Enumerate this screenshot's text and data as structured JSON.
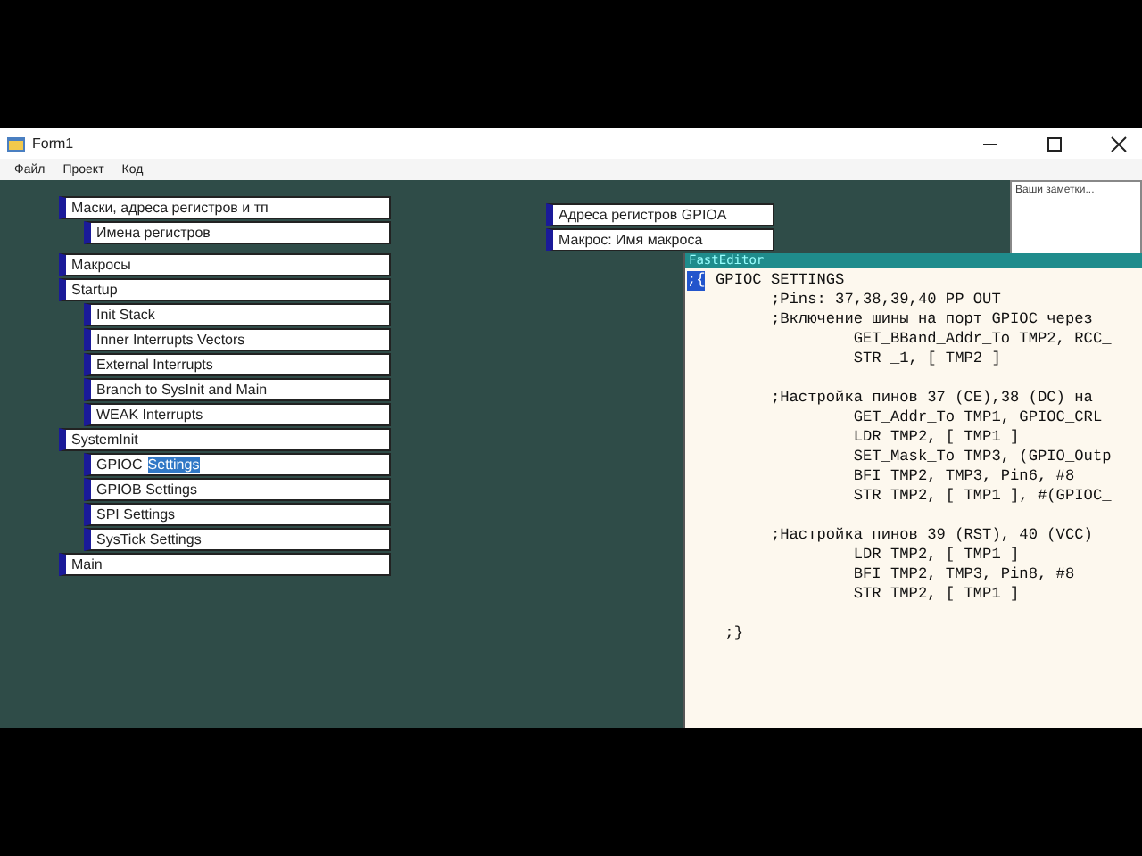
{
  "window": {
    "title": "Form1"
  },
  "menu": [
    "Файл",
    "Проект",
    "Код"
  ],
  "tree_groups": [
    [
      {
        "label": "Маски, адреса регистров и тп",
        "children": [
          {
            "label": "Имена регистров"
          }
        ]
      }
    ],
    [
      {
        "label": "Макросы"
      },
      {
        "label": "Startup",
        "children": [
          {
            "label": "Init Stack"
          },
          {
            "label": "Inner Interrupts Vectors"
          },
          {
            "label": "External Interrupts"
          },
          {
            "label": "Branch to SysInit and Main"
          },
          {
            "label": "WEAK Interrupts"
          }
        ]
      },
      {
        "label": "SystemInit",
        "children": [
          {
            "label": "GPIOC",
            "selected_text": "Settings"
          },
          {
            "label": "GPIOB Settings"
          },
          {
            "label": "SPI Settings"
          },
          {
            "label": "SysTick Settings"
          }
        ]
      },
      {
        "label": "Main"
      }
    ]
  ],
  "floating_nodes": [
    "Адреса регистров GPIOA",
    "Макрос: Имя макроса"
  ],
  "notes": {
    "placeholder": "Ваши заметки..."
  },
  "editor": {
    "title": "FastEditor",
    "marker": ";{",
    "blocks": [
      [
        "GPIOC SETTINGS",
        "      ;Pins: 37,38,39,40 PP OUT",
        "      ;Включение шины на порт GPIOC через",
        "               GET_BBand_Addr_To TMP2, RCC_",
        "               STR _1, [ TMP2 ]"
      ],
      [
        "      ;Настройка пинов 37 (CE),38 (DC) на",
        "               GET_Addr_To TMP1, GPIOC_CRL",
        "               LDR TMP2, [ TMP1 ]",
        "               SET_Mask_To TMP3, (GPIO_Outp",
        "               BFI TMP2, TMP3, Pin6, #8",
        "               STR TMP2, [ TMP1 ], #(GPIOC_"
      ],
      [
        "      ;Настройка пинов 39 (RST), 40 (VCC)",
        "               LDR TMP2, [ TMP1 ]",
        "               BFI TMP2, TMP3, Pin8, #8",
        "               STR TMP2, [ TMP1 ]"
      ],
      [
        " ;}"
      ]
    ]
  }
}
